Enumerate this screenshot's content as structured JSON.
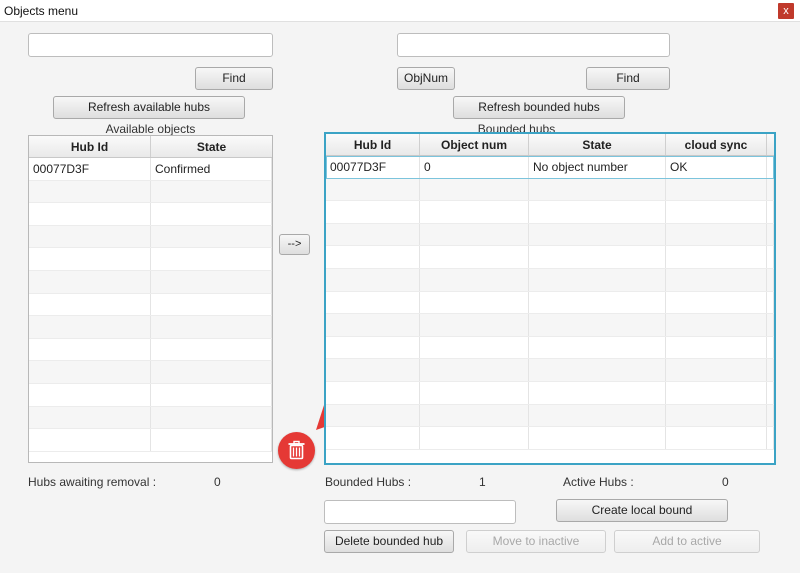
{
  "window": {
    "title": "Objects menu",
    "close_label": "x"
  },
  "left": {
    "find_label": "Find",
    "refresh_label": "Refresh available hubs",
    "table_title": "Available objects",
    "columns": [
      "Hub Id",
      "State"
    ],
    "rows": [
      [
        "00077D3F",
        "Confirmed"
      ]
    ],
    "awaiting_label": "Hubs awaiting removal :",
    "awaiting_count": "0"
  },
  "middle": {
    "transfer_label": "-->"
  },
  "right": {
    "objnum_label": "ObjNum",
    "find_label": "Find",
    "refresh_label": "Refresh bounded hubs",
    "table_title": "Bounded hubs",
    "columns": [
      "Hub Id",
      "Object num",
      "State",
      "cloud sync"
    ],
    "rows": [
      [
        "00077D3F",
        "0",
        "No object number",
        "OK"
      ]
    ],
    "bounded_label": "Bounded Hubs :",
    "bounded_count": "1",
    "active_label": "Active Hubs :",
    "active_count": "0",
    "create_local_bound_label": "Create local bound",
    "delete_bounded_label": "Delete bounded hub",
    "move_inactive_label": "Move to inactive",
    "add_active_label": "Add to active"
  },
  "colors": {
    "accent": "#3ba3c5",
    "delete_button": "#e53935",
    "annotation_arrow": "#e53935"
  },
  "icons": {
    "delete": "trash-icon"
  }
}
